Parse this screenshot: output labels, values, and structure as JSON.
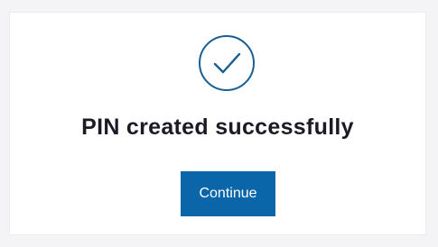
{
  "dialog": {
    "icon": "checkmark-circle-icon",
    "title": "PIN created successfully",
    "continue_label": "Continue"
  },
  "colors": {
    "page_background": "#f4f4f6",
    "card_background": "#ffffff",
    "icon_stroke": "#1a5f91",
    "title_text": "#1b1b24",
    "button_background": "#0a66a8",
    "button_text": "#ffffff"
  }
}
